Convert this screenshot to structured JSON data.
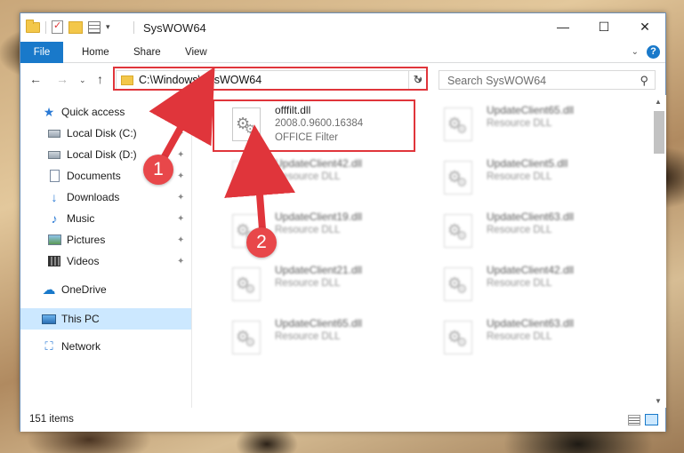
{
  "window": {
    "title": "SysWOW64",
    "controls": {
      "minimize": "—",
      "maximize": "☐",
      "close": "✕"
    }
  },
  "ribbon": {
    "tabs": [
      "File",
      "Home",
      "Share",
      "View"
    ],
    "expand": "⌄",
    "help": "?"
  },
  "navigation": {
    "back": "←",
    "forward": "→",
    "recent": "⌄",
    "up": "↑",
    "address": "C:\\Windows\\SysWOW64",
    "refresh": "↻",
    "search_placeholder": "Search SysWOW64",
    "search_icon": "⚲"
  },
  "sidebar": {
    "items": [
      {
        "label": "Quick access",
        "icon": "star-icon",
        "pinned": false
      },
      {
        "label": "Local Disk (C:)",
        "icon": "drive-icon",
        "pinned": true
      },
      {
        "label": "Local Disk (D:)",
        "icon": "drive-icon",
        "pinned": true
      },
      {
        "label": "Documents",
        "icon": "documents-icon",
        "pinned": true
      },
      {
        "label": "Downloads",
        "icon": "downloads-icon",
        "pinned": true
      },
      {
        "label": "Music",
        "icon": "music-icon",
        "pinned": true
      },
      {
        "label": "Pictures",
        "icon": "pictures-icon",
        "pinned": true
      },
      {
        "label": "Videos",
        "icon": "videos-icon",
        "pinned": true
      },
      {
        "label": "OneDrive",
        "icon": "onedrive-icon",
        "pinned": false
      },
      {
        "label": "This PC",
        "icon": "this-pc-icon",
        "pinned": false,
        "selected": true
      },
      {
        "label": "Network",
        "icon": "network-icon",
        "pinned": false
      }
    ],
    "pin_glyph": "📌"
  },
  "files": [
    {
      "name": "offfilt.dll",
      "line1": "2008.0.9600.16384",
      "line2": "OFFICE Filter",
      "highlighted": true
    },
    {
      "name": "UpdateClient65.dll",
      "line1": "Resource DLL",
      "line2": ""
    },
    {
      "name": "UpdateClient42.dll",
      "line1": "Resource DLL",
      "line2": ""
    },
    {
      "name": "UpdateClient5.dll",
      "line1": "Resource DLL",
      "line2": ""
    },
    {
      "name": "UpdateClient19.dll",
      "line1": "Resource DLL",
      "line2": ""
    },
    {
      "name": "UpdateClient63.dll",
      "line1": "Resource DLL",
      "line2": ""
    },
    {
      "name": "UpdateClient21.dll",
      "line1": "Resource DLL",
      "line2": ""
    },
    {
      "name": "UpdateClient42.dll",
      "line1": "Resource DLL",
      "line2": ""
    },
    {
      "name": "UpdateClient65.dll",
      "line1": "Resource DLL",
      "line2": ""
    },
    {
      "name": "UpdateClient63.dll",
      "line1": "Resource DLL",
      "line2": ""
    }
  ],
  "statusbar": {
    "item_count": "151 items"
  },
  "annotations": {
    "step1": "1",
    "step2": "2",
    "color": "#e0353b"
  }
}
